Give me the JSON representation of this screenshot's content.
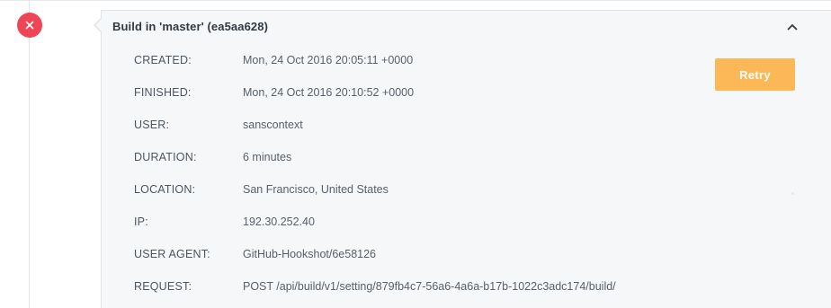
{
  "build": {
    "title": "Build in 'master' (ea5aa628)",
    "status": "failed",
    "retry_label": "Retry",
    "details": [
      {
        "label": "CREATED:",
        "value": "Mon, 24 Oct 2016 20:05:11 +0000"
      },
      {
        "label": "FINISHED:",
        "value": "Mon, 24 Oct 2016 20:10:52 +0000"
      },
      {
        "label": "USER:",
        "value": "sanscontext"
      },
      {
        "label": "DURATION:",
        "value": "6 minutes"
      },
      {
        "label": "LOCATION:",
        "value": "San Francisco, United States"
      },
      {
        "label": "IP:",
        "value": "192.30.252.40"
      },
      {
        "label": "USER AGENT:",
        "value": "GitHub-Hookshot/6e58126"
      },
      {
        "label": "REQUEST:",
        "value": "POST /api/build/v1/setting/879fb4c7-56a6-4a6a-b17b-1022c3adc174/build/"
      }
    ]
  },
  "icons": {
    "status": "close-icon",
    "collapse": "chevron-up-icon"
  },
  "colors": {
    "failed": "#ee4655",
    "retry_button": "#fcb857",
    "card_background": "#f6f7f8",
    "title_text": "#2f3a44"
  }
}
